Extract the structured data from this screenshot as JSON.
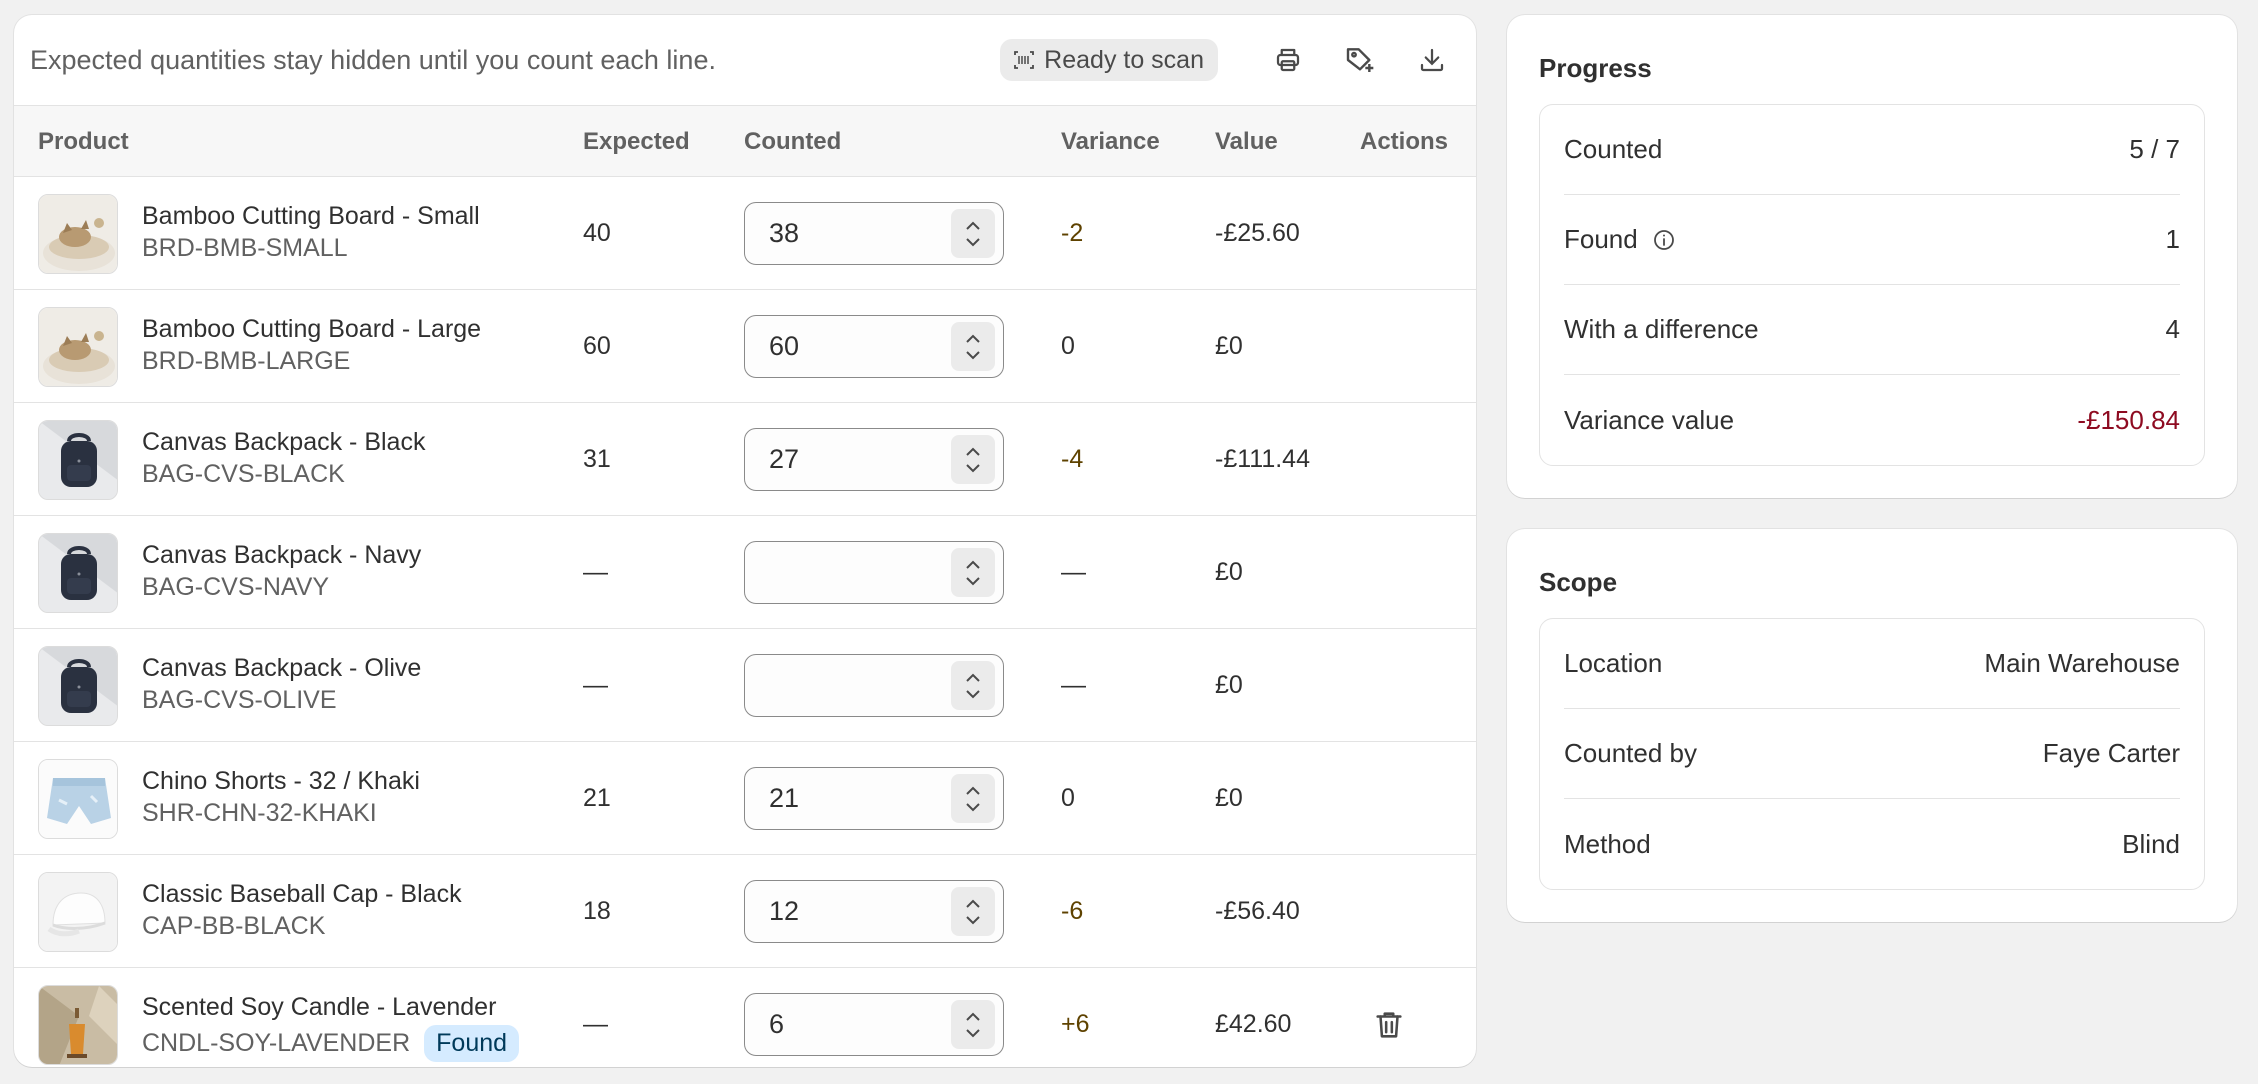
{
  "header": {
    "note": "Expected quantities stay hidden until you count each line.",
    "scan_label": "Ready to scan"
  },
  "icons": {
    "scan": "barcode-scan-icon",
    "print": "printer-icon",
    "tag": "tag-add-icon",
    "download": "download-icon",
    "stepper": "chevron-up-down-icon",
    "delete": "trash-icon",
    "info": "info-icon"
  },
  "table": {
    "columns": {
      "product": "Product",
      "expected": "Expected",
      "counted": "Counted",
      "variance": "Variance",
      "value": "Value",
      "actions": "Actions"
    },
    "rows": [
      {
        "name": "Bamboo Cutting Board - Small",
        "sku": "BRD-BMB-SMALL",
        "expected": "40",
        "counted": "38",
        "variance": "-2",
        "value": "-£25.60",
        "thumb": "cat-bed"
      },
      {
        "name": "Bamboo Cutting Board - Large",
        "sku": "BRD-BMB-LARGE",
        "expected": "60",
        "counted": "60",
        "variance": "0",
        "value": "£0",
        "thumb": "cat-bed"
      },
      {
        "name": "Canvas Backpack - Black",
        "sku": "BAG-CVS-BLACK",
        "expected": "31",
        "counted": "27",
        "variance": "-4",
        "value": "-£111.44",
        "thumb": "backpack"
      },
      {
        "name": "Canvas Backpack - Navy",
        "sku": "BAG-CVS-NAVY",
        "expected": "—",
        "counted": "",
        "variance": "—",
        "value": "£0",
        "thumb": "backpack"
      },
      {
        "name": "Canvas Backpack - Olive",
        "sku": "BAG-CVS-OLIVE",
        "expected": "—",
        "counted": "",
        "variance": "—",
        "value": "£0",
        "thumb": "backpack"
      },
      {
        "name": "Chino Shorts - 32 / Khaki",
        "sku": "SHR-CHN-32-KHAKI",
        "expected": "21",
        "counted": "21",
        "variance": "0",
        "value": "£0",
        "thumb": "shorts"
      },
      {
        "name": "Classic Baseball Cap - Black",
        "sku": "CAP-BB-BLACK",
        "expected": "18",
        "counted": "12",
        "variance": "-6",
        "value": "-£56.40",
        "thumb": "cap"
      },
      {
        "name": "Scented Soy Candle - Lavender",
        "sku": "CNDL-SOY-LAVENDER",
        "badge": "Found",
        "expected": "—",
        "counted": "6",
        "variance": "+6",
        "value": "£42.60",
        "thumb": "candle"
      }
    ]
  },
  "progress": {
    "title": "Progress",
    "items": [
      {
        "label": "Counted",
        "value": "5 / 7"
      },
      {
        "label": "Found",
        "value": "1"
      },
      {
        "label": "With a difference",
        "value": "4"
      },
      {
        "label": "Variance value",
        "value": "-£150.84"
      }
    ]
  },
  "scope": {
    "title": "Scope",
    "items": [
      {
        "label": "Location",
        "value": "Main Warehouse"
      },
      {
        "label": "Counted by",
        "value": "Faye Carter"
      },
      {
        "label": "Method",
        "value": "Blind"
      }
    ]
  },
  "colors": {
    "negative_value": "#8e0b21",
    "variance_text": "#5e4200",
    "found_badge_bg": "#d5ebff"
  }
}
